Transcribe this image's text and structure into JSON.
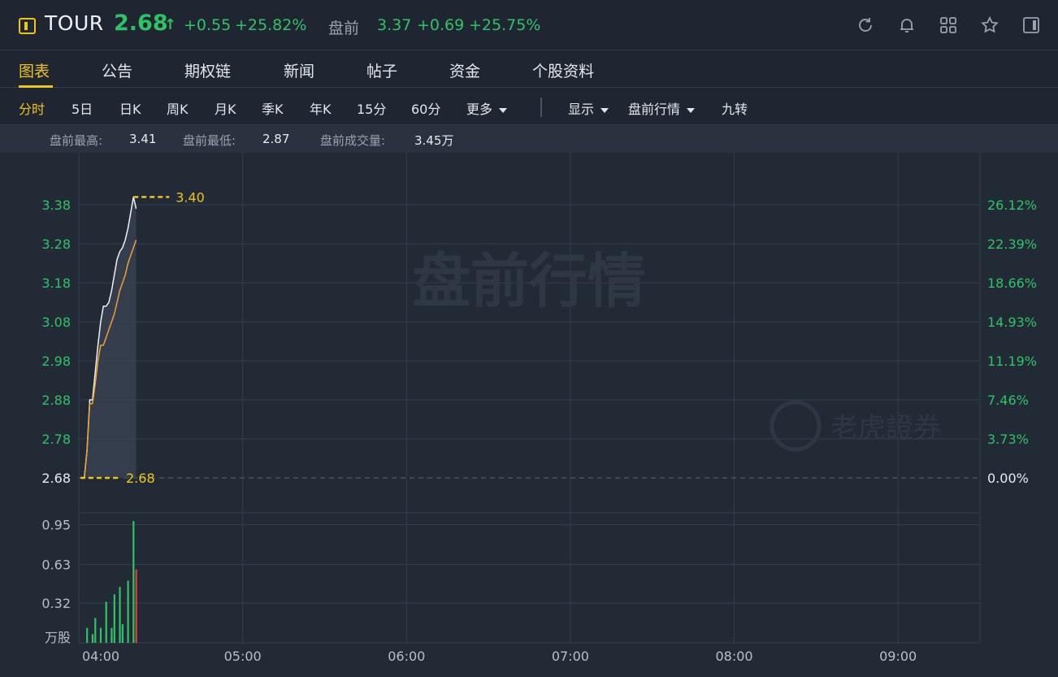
{
  "header": {
    "symbol": "TOUR",
    "last_price": "2.68",
    "change": "+0.55",
    "change_pct": "+25.82%",
    "premarket_label": "盘前",
    "premarket_price": "3.37",
    "premarket_change": "+0.69",
    "premarket_change_pct": "+25.75%",
    "up_color": "#2ec466",
    "accent_color": "#f0c419",
    "icons": [
      "refresh-icon",
      "bell-icon",
      "grid-icon",
      "star-icon",
      "panel-icon"
    ]
  },
  "tabs": [
    {
      "label": "图表",
      "active": true
    },
    {
      "label": "公告"
    },
    {
      "label": "期权链"
    },
    {
      "label": "新闻"
    },
    {
      "label": "帖子"
    },
    {
      "label": "资金"
    },
    {
      "label": "个股资料"
    }
  ],
  "periods": [
    {
      "label": "分时",
      "active": true
    },
    {
      "label": "5日"
    },
    {
      "label": "日K"
    },
    {
      "label": "周K"
    },
    {
      "label": "月K"
    },
    {
      "label": "季K"
    },
    {
      "label": "年K"
    },
    {
      "label": "15分"
    },
    {
      "label": "60分"
    },
    {
      "label": "更多"
    }
  ],
  "toolbar": {
    "display_label": "显示",
    "session_label": "盘前行情",
    "nine_turn_label": "九转"
  },
  "info": {
    "high_label": "盘前最高:",
    "high_value": "3.41",
    "low_label": "盘前最低:",
    "low_value": "2.87",
    "volume_label": "盘前成交量:",
    "volume_value": "3.45万"
  },
  "chart_data": {
    "type": "line",
    "watermark": "盘前行情",
    "brand_watermark": "老虎證券",
    "y_ticks_left": [
      "3.38",
      "3.28",
      "3.18",
      "3.08",
      "2.98",
      "2.88",
      "2.78",
      "2.68"
    ],
    "y_ticks_right": [
      "26.12%",
      "22.39%",
      "18.66%",
      "14.93%",
      "11.19%",
      "7.46%",
      "3.73%",
      "0.00%"
    ],
    "ylim": [
      2.68,
      3.43
    ],
    "volume_ticks": [
      "0.95",
      "0.63",
      "0.32"
    ],
    "volume_unit": "万股",
    "volume_ylim": [
      0,
      1.0
    ],
    "x_ticks": [
      "04:00",
      "05:00",
      "06:00",
      "07:00",
      "08:00",
      "09:00"
    ],
    "x_range_minutes": [
      0,
      330
    ],
    "high_marker": {
      "value": 3.4,
      "label": "3.40"
    },
    "base_marker": {
      "value": 2.68,
      "label": "2.68"
    },
    "series": [
      {
        "color": "#eef1f5",
        "points": [
          [
            2,
            2.68
          ],
          [
            3,
            2.75
          ],
          [
            4,
            2.88
          ],
          [
            5,
            2.88
          ],
          [
            6,
            2.95
          ],
          [
            7,
            3.02
          ],
          [
            8,
            3.08
          ],
          [
            9,
            3.12
          ],
          [
            10,
            3.12
          ],
          [
            11,
            3.13
          ],
          [
            12,
            3.16
          ],
          [
            13,
            3.2
          ],
          [
            14,
            3.24
          ],
          [
            15,
            3.26
          ],
          [
            16,
            3.27
          ],
          [
            17,
            3.29
          ],
          [
            18,
            3.32
          ],
          [
            19,
            3.36
          ],
          [
            20,
            3.4
          ],
          [
            21,
            3.37
          ]
        ]
      },
      {
        "color": "#f0a030",
        "points": [
          [
            2,
            2.68
          ],
          [
            3,
            2.75
          ],
          [
            4,
            2.87
          ],
          [
            5,
            2.87
          ],
          [
            6,
            2.92
          ],
          [
            7,
            2.98
          ],
          [
            8,
            3.02
          ],
          [
            9,
            3.02
          ],
          [
            10,
            3.04
          ],
          [
            11,
            3.06
          ],
          [
            12,
            3.08
          ],
          [
            13,
            3.1
          ],
          [
            14,
            3.13
          ],
          [
            15,
            3.16
          ],
          [
            16,
            3.18
          ],
          [
            17,
            3.2
          ],
          [
            18,
            3.23
          ],
          [
            19,
            3.25
          ],
          [
            20,
            3.27
          ],
          [
            21,
            3.29
          ]
        ]
      }
    ],
    "volume_bars": [
      {
        "t": 3,
        "v": 0.12,
        "color": "#2ec466"
      },
      {
        "t": 5,
        "v": 0.07,
        "color": "#2ec466"
      },
      {
        "t": 6,
        "v": 0.2,
        "color": "#2ec466"
      },
      {
        "t": 8,
        "v": 0.12,
        "color": "#2ec466"
      },
      {
        "t": 10,
        "v": 0.33,
        "color": "#2ec466"
      },
      {
        "t": 12,
        "v": 0.12,
        "color": "#2ec466"
      },
      {
        "t": 13,
        "v": 0.39,
        "color": "#2ec466"
      },
      {
        "t": 15,
        "v": 0.45,
        "color": "#2ec466"
      },
      {
        "t": 16,
        "v": 0.15,
        "color": "#2ec466"
      },
      {
        "t": 18,
        "v": 0.5,
        "color": "#2ec466"
      },
      {
        "t": 20,
        "v": 0.98,
        "color": "#2ec466"
      },
      {
        "t": 21,
        "v": 0.59,
        "color": "#e0413d"
      }
    ]
  }
}
